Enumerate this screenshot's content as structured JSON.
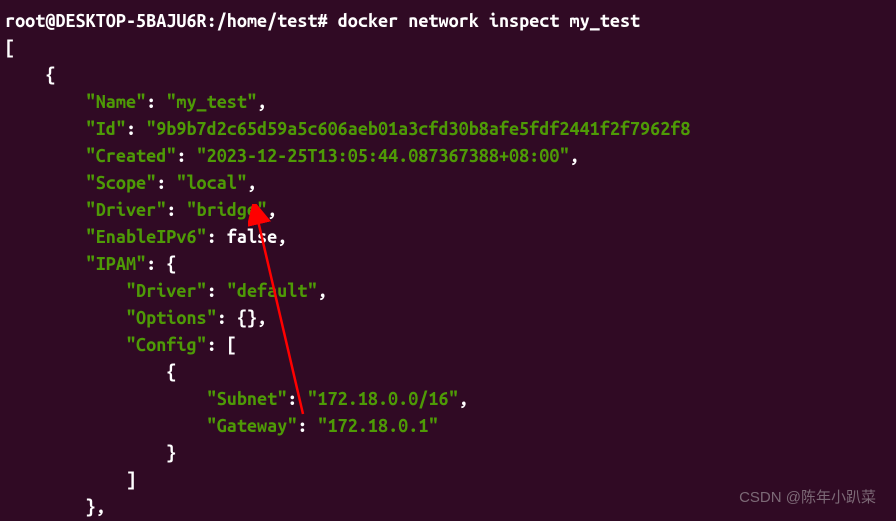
{
  "prompt": {
    "user_host": "root@DESKTOP-5BAJU6R",
    "separator": ":",
    "path": "/home/test",
    "symbol": "#",
    "command": "docker network inspect my_test"
  },
  "json": {
    "open_bracket": "[",
    "open_brace": "{",
    "name_key": "\"Name\"",
    "name_val": "\"my_test\"",
    "id_key": "\"Id\"",
    "id_val": "\"9b9b7d2c65d59a5c606aeb01a3cfd30b8afe5fdf2441f2f7962f8",
    "created_key": "\"Created\"",
    "created_val": "\"2023-12-25T13:05:44.087367388+08:00\"",
    "scope_key": "\"Scope\"",
    "scope_val": "\"local\"",
    "driver_key": "\"Driver\"",
    "driver_val": "\"bridge\"",
    "enableipv6_key": "\"EnableIPv6\"",
    "enableipv6_val": "false",
    "ipam_key": "\"IPAM\"",
    "ipam_open": "{",
    "ipam_driver_key": "\"Driver\"",
    "ipam_driver_val": "\"default\"",
    "options_key": "\"Options\"",
    "options_val": "{}",
    "config_key": "\"Config\"",
    "config_open": "[",
    "config_brace": "{",
    "subnet_key": "\"Subnet\"",
    "subnet_val": "\"172.18.0.0/16\"",
    "gateway_key": "\"Gateway\"",
    "gateway_val": "\"172.18.0.1\"",
    "config_close_brace": "}",
    "config_close_bracket": "]",
    "ipam_close": "},"
  },
  "watermark": "CSDN @陈年小趴菜"
}
